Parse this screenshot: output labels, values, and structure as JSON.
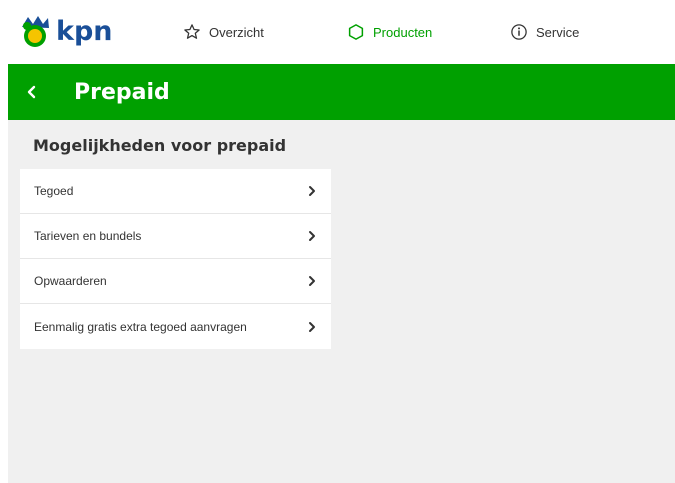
{
  "header": {
    "logo_text": "kpn",
    "nav": {
      "overzicht": "Overzicht",
      "producten": "Producten",
      "service": "Service"
    }
  },
  "page": {
    "title": "Prepaid",
    "section_title": "Mogelijkheden voor prepaid"
  },
  "list": {
    "items": [
      {
        "label": "Tegoed"
      },
      {
        "label": "Tarieven en bundels"
      },
      {
        "label": "Opwaarderen"
      },
      {
        "label": "Eenmalig gratis extra tegoed aanvragen"
      }
    ]
  },
  "colors": {
    "brand_green": "#00a000",
    "brand_blue": "#1a4f98",
    "background_gray": "#f0f0f0"
  }
}
